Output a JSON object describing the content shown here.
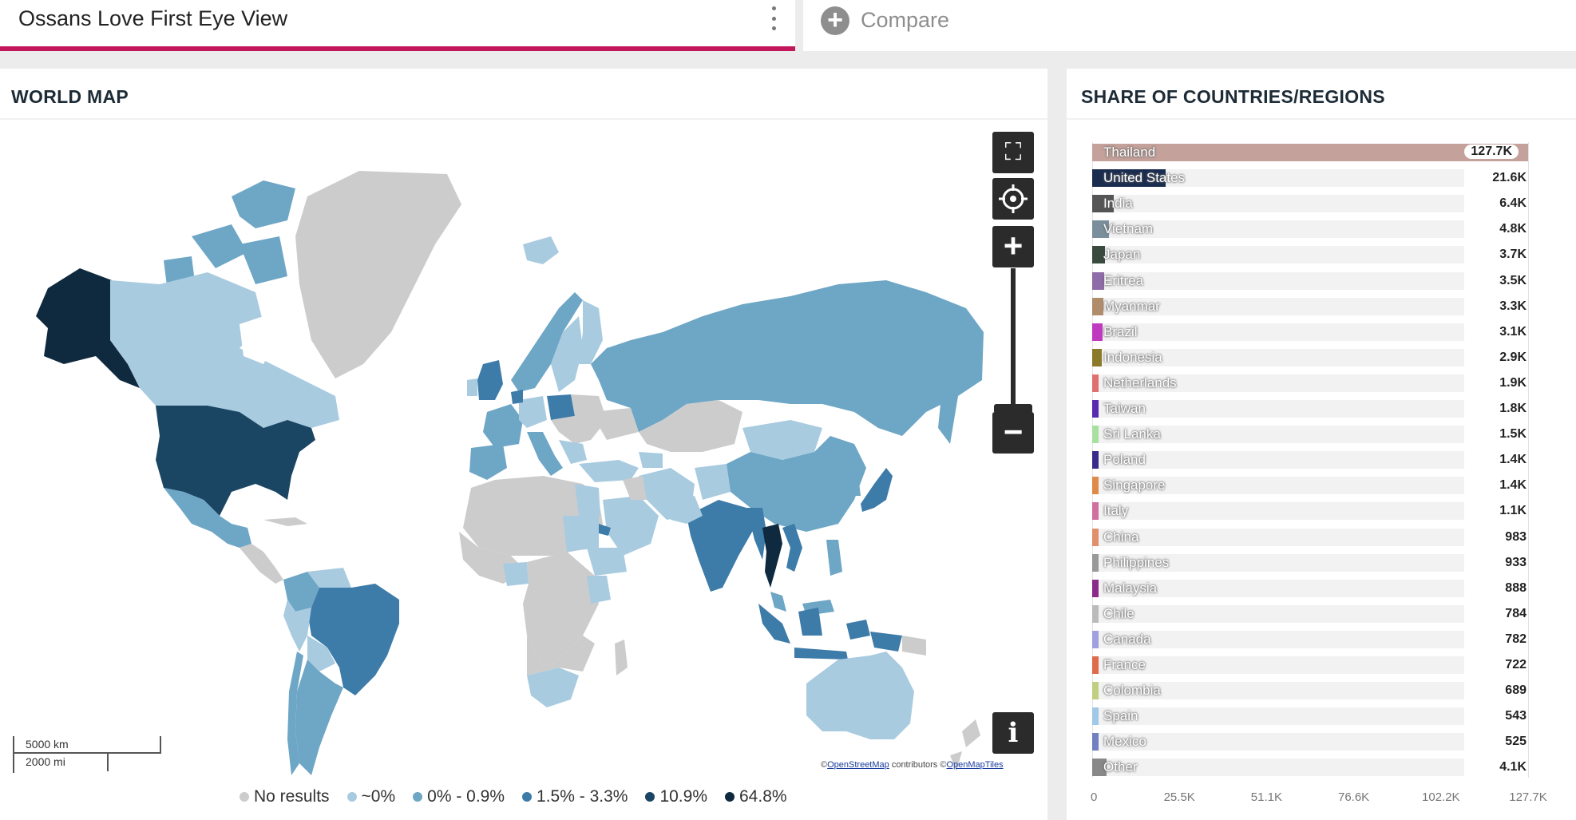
{
  "tabs": {
    "active_title": "Ossans Love First Eye View",
    "compare_label": "Compare"
  },
  "map_panel": {
    "title": "WORLD MAP",
    "scale_km": "5000 km",
    "scale_mi": "2000 mi",
    "attribution_prefix": "©",
    "attribution_osm": "OpenStreetMap",
    "attribution_mid": " contributors  ©",
    "attribution_tiles": "OpenMapTiles",
    "legend": [
      {
        "label": "No results",
        "color": "#cccccc"
      },
      {
        "label": "~0%",
        "color": "#a9cbe0"
      },
      {
        "label": "0% - 0.9%",
        "color": "#6ea6c6"
      },
      {
        "label": "1.5% - 3.3%",
        "color": "#3d7ba8"
      },
      {
        "label": "10.9%",
        "color": "#1b4663"
      },
      {
        "label": "64.8%",
        "color": "#0f2a3f"
      }
    ],
    "colors": {
      "none": "#cccccc",
      "approx0": "#a9cbe0",
      "low": "#6ea6c6",
      "mid": "#3d7ba8",
      "high": "#1b4663",
      "top": "#0f2a3f"
    }
  },
  "share_panel": {
    "title": "SHARE OF COUNTRIES/REGIONS",
    "xticks": [
      "0",
      "25.5K",
      "51.1K",
      "76.6K",
      "102.2K",
      "127.7K"
    ],
    "xmax": 127700
  },
  "chart_data": {
    "type": "bar",
    "orientation": "horizontal",
    "categories": [
      "Thailand",
      "United States",
      "India",
      "Vietnam",
      "Japan",
      "Eritrea",
      "Myanmar",
      "Brazil",
      "Indonesia",
      "Netherlands",
      "Taiwan",
      "Sri Lanka",
      "Poland",
      "Singapore",
      "Italy",
      "China",
      "Philippines",
      "Malaysia",
      "Chile",
      "Canada",
      "France",
      "Colombia",
      "Spain",
      "Mexico",
      "Other"
    ],
    "values": [
      127700,
      21600,
      6400,
      4800,
      3700,
      3500,
      3300,
      3100,
      2900,
      1900,
      1800,
      1500,
      1400,
      1400,
      1100,
      983,
      933,
      888,
      784,
      782,
      722,
      689,
      543,
      525,
      4100
    ],
    "value_labels": [
      "127.7K",
      "21.6K",
      "6.4K",
      "4.8K",
      "3.7K",
      "3.5K",
      "3.3K",
      "3.1K",
      "2.9K",
      "1.9K",
      "1.8K",
      "1.5K",
      "1.4K",
      "1.4K",
      "1.1K",
      "983",
      "933",
      "888",
      "784",
      "782",
      "722",
      "689",
      "543",
      "525",
      "4.1K"
    ],
    "colors": [
      "#c4a19a",
      "#1b2d4f",
      "#555555",
      "#7a8f9b",
      "#3a4a3e",
      "#8f6ba8",
      "#b08d6a",
      "#c03ac0",
      "#8a7a2a",
      "#e07070",
      "#5a2ab0",
      "#a8e0a0",
      "#3a2a8a",
      "#e08a4a",
      "#d070a0",
      "#e0906a",
      "#999999",
      "#8a2a8a",
      "#bbbbbb",
      "#a0a0e0",
      "#e06a4a",
      "#c0d080",
      "#a0c8e8",
      "#7080c0",
      "#888888"
    ],
    "xlim": [
      0,
      127700
    ]
  }
}
